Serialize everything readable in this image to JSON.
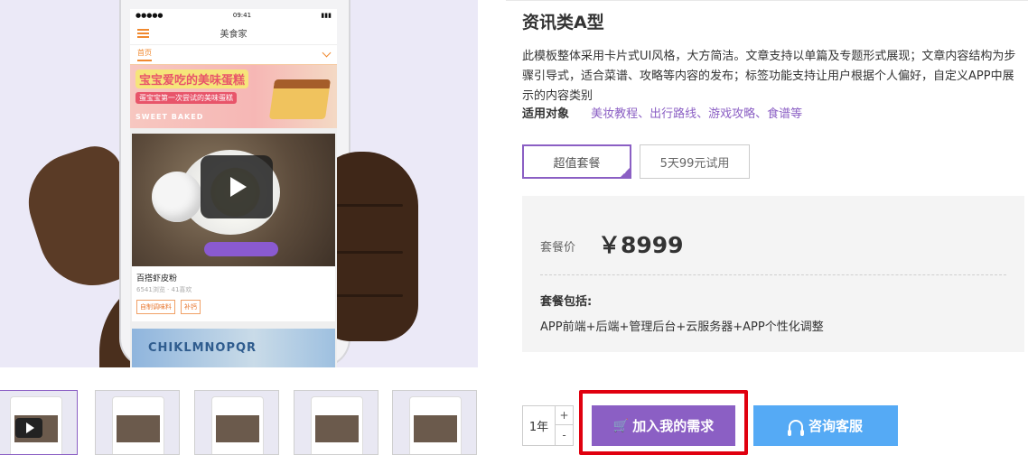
{
  "hero": {
    "status_time": "09:41",
    "status_signal": "●●●●● ",
    "app_title": "美食家",
    "tab_home": "首页",
    "banner_title": "宝宝爱吃的美味蛋糕",
    "banner_subtitle": "蛋宝宝第一次尝试的美味蛋糕",
    "banner_brand": "SWEET BAKED",
    "card_title": "百搭虾皮粉",
    "card_meta": "6541浏览 · 41喜欢",
    "card_tags": [
      "自制调味料",
      "补钙"
    ],
    "card2_text": "CHIKLMNOPQR"
  },
  "thumbnails": [
    {
      "active": true
    },
    {
      "active": false
    },
    {
      "active": false
    },
    {
      "active": false
    },
    {
      "active": false
    }
  ],
  "product": {
    "title": "资讯类A型",
    "description": "此模板整体采用卡片式UI风格，大方简洁。文章支持以单篇及专题形式展现；文章内容结构为步骤引导式，适合菜谱、攻略等内容的发布；标签功能支持让用户根据个人偏好，自定义APP中展示的内容类别",
    "applies_label": "适用对象",
    "applies_value": "美妆教程、出行路线、游戏攻略、食谱等",
    "package_options": [
      "超值套餐",
      "5天99元试用"
    ],
    "selected_package": "超值套餐",
    "price_label": "套餐价",
    "price_value": "￥8999",
    "includes_label": "套餐包括:",
    "includes_value": "APP前端+后端+管理后台+云服务器+APP个性化调整"
  },
  "actions": {
    "quantity": "1年",
    "qty_up": "+",
    "qty_down": "-",
    "add_label": "加入我的需求",
    "consult_label": "咨询客服"
  },
  "colors": {
    "accent": "#8b5fc4",
    "consult": "#55aaf5",
    "highlight": "#e0000f"
  }
}
